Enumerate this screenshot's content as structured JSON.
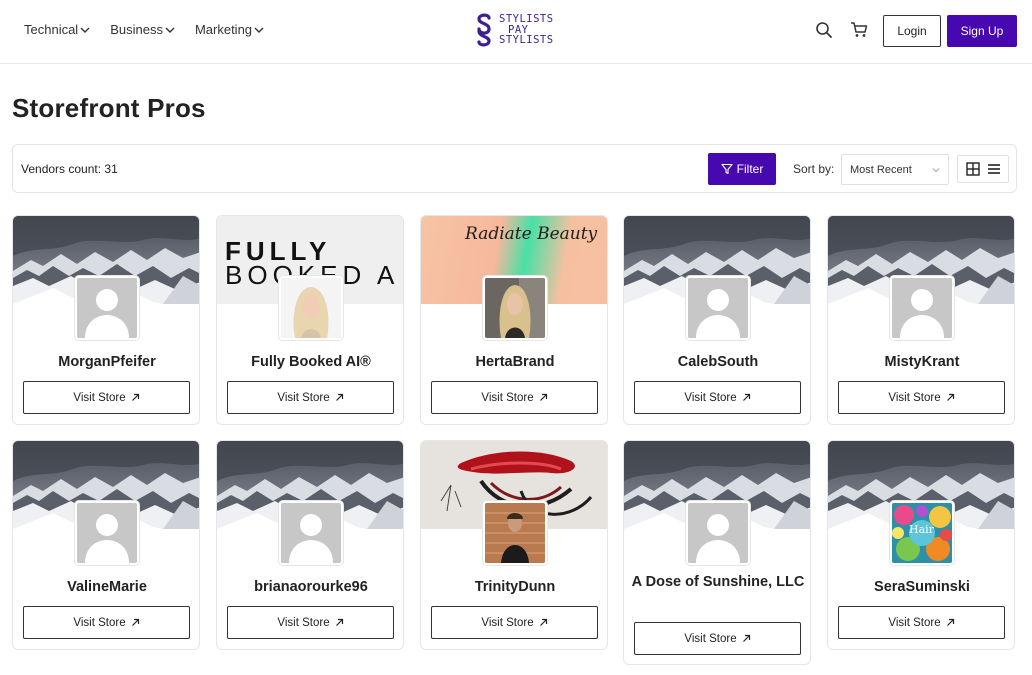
{
  "nav": {
    "items": [
      {
        "label": "Technical"
      },
      {
        "label": "Business"
      },
      {
        "label": "Marketing"
      }
    ]
  },
  "logo": {
    "line1": "STYLISTS",
    "line2": "PAY",
    "line3": "STYLISTS"
  },
  "header": {
    "login_label": "Login",
    "signup_label": "Sign Up",
    "search_icon": "search-icon",
    "cart_icon": "cart-icon"
  },
  "page": {
    "title": "Storefront Pros"
  },
  "toolbar": {
    "vendors_count": "Vendors count: 31",
    "filter_label": "Filter",
    "sort_label": "Sort by:",
    "sort_value": "Most Recent"
  },
  "colors": {
    "brand": "#4808b0",
    "logo": "#3d1f8f"
  },
  "vendors": [
    {
      "name": "MorganPfeifer",
      "visit_label": "Visit Store",
      "cover": "mountains",
      "avatar": "placeholder"
    },
    {
      "name": "Fully Booked AI®",
      "visit_label": "Visit Store",
      "cover": "fully-booked",
      "cover_text_1": "FULLY",
      "cover_text_2": "BOOKED A",
      "avatar": "photo-blonde"
    },
    {
      "name": "HertaBrand",
      "visit_label": "Visit Store",
      "cover": "radiate",
      "cover_text_1": "Radiate Beauty",
      "avatar": "photo-blonde-2"
    },
    {
      "name": "CalebSouth",
      "visit_label": "Visit Store",
      "cover": "mountains",
      "avatar": "placeholder"
    },
    {
      "name": "MistyKrant",
      "visit_label": "Visit Store",
      "cover": "mountains",
      "avatar": "placeholder"
    },
    {
      "name": "ValineMarie",
      "visit_label": "Visit Store",
      "cover": "mountains",
      "avatar": "placeholder"
    },
    {
      "name": "brianaorourke96",
      "visit_label": "Visit Store",
      "cover": "mountains",
      "avatar": "placeholder"
    },
    {
      "name": "TrinityDunn",
      "visit_label": "Visit Store",
      "cover": "lips-art",
      "avatar": "photo-brick"
    },
    {
      "name": "A Dose of Sunshine, LLC",
      "visit_label": "Visit Store",
      "cover": "mountains",
      "avatar": "placeholder"
    },
    {
      "name": "SeraSuminski",
      "visit_label": "Visit Store",
      "cover": "mountains",
      "avatar": "hair-art",
      "avatar_text": "Hair"
    }
  ]
}
